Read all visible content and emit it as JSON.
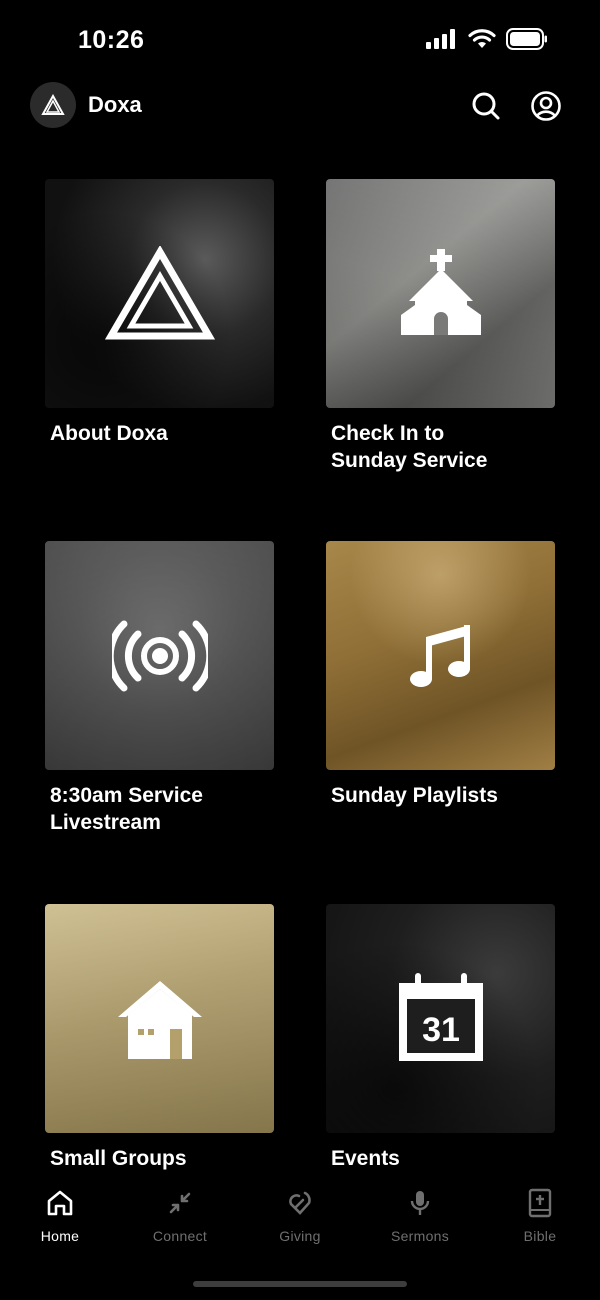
{
  "status": {
    "time": "10:26"
  },
  "header": {
    "title": "Doxa"
  },
  "tiles": [
    {
      "label": "About Doxa",
      "icon": "triangle-logo-icon"
    },
    {
      "label": "Check In to\nSunday Service",
      "icon": "church-icon"
    },
    {
      "label": "8:30am Service\nLivestream",
      "icon": "broadcast-icon"
    },
    {
      "label": "Sunday Playlists",
      "icon": "music-note-icon"
    },
    {
      "label": "Small Groups",
      "icon": "house-icon"
    },
    {
      "label": "Events",
      "icon": "calendar-icon",
      "calendar_day": "31"
    }
  ],
  "tabs": [
    {
      "label": "Home",
      "icon": "home-icon",
      "active": true
    },
    {
      "label": "Connect",
      "icon": "connect-icon",
      "active": false
    },
    {
      "label": "Giving",
      "icon": "giving-icon",
      "active": false
    },
    {
      "label": "Sermons",
      "icon": "microphone-icon",
      "active": false
    },
    {
      "label": "Bible",
      "icon": "bible-icon",
      "active": false
    }
  ],
  "colors": {
    "background": "#000000",
    "active_tab": "#ffffff",
    "inactive_tab": "#6f6f6f",
    "playlist_tint": "#a8874a",
    "groups_tint": "#c9b885"
  }
}
